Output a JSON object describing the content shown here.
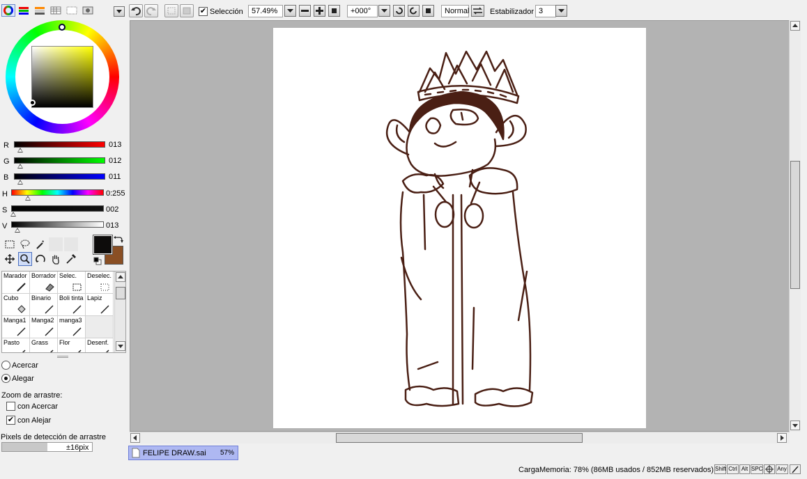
{
  "toolbar": {
    "selection_label": "Selección",
    "selection_checked": true,
    "zoom_value": "57.49%",
    "rotation_value": "+000°",
    "blend_mode": "Normal",
    "stabilizer_label": "Estabilizador",
    "stabilizer_value": "3"
  },
  "color_panel": {
    "tabs": [
      "color-wheel-icon",
      "rgb-sliders-icon",
      "hsv-sliders-icon",
      "swatches-icon",
      "scratchpad-icon",
      "palette-icon"
    ],
    "sliders": [
      {
        "label": "R",
        "value": "013"
      },
      {
        "label": "G",
        "value": "012"
      },
      {
        "label": "B",
        "value": "011"
      },
      {
        "label": "H",
        "value": "0:255"
      },
      {
        "label": "S",
        "value": "002"
      },
      {
        "label": "V",
        "value": "013"
      }
    ],
    "primary_color": "#0d0c0b",
    "secondary_color": "#8a4f24"
  },
  "brushes": [
    {
      "name": "Marador"
    },
    {
      "name": "Borrador"
    },
    {
      "name": "Selec."
    },
    {
      "name": "Deselec."
    },
    {
      "name": "Cubo"
    },
    {
      "name": "Binario"
    },
    {
      "name": "Boli tinta"
    },
    {
      "name": "Lapiz"
    },
    {
      "name": "Manga1"
    },
    {
      "name": "Manga2"
    },
    {
      "name": "manga3"
    },
    {
      "name": ""
    },
    {
      "name": "Pasto"
    },
    {
      "name": "Grass"
    },
    {
      "name": "Flor"
    },
    {
      "name": "Desenf."
    }
  ],
  "zoom_options": {
    "zoom_in_label": "Acercar",
    "zoom_out_label": "Alegar",
    "selected": "Alegar",
    "drag_zoom_label": "Zoom de arrastre:",
    "with_zoom_in_label": "con Acercar",
    "with_zoom_in_checked": false,
    "with_zoom_out_label": "con Alejar",
    "with_zoom_out_checked": true,
    "drag_pixels_label": "Pixels de detección de arrastre",
    "drag_pixels_value": "±16pix",
    "drag_pixels_fraction": 0.5
  },
  "document_tab": {
    "filename": "FELIPE DRAW.sai",
    "zoom": "57%"
  },
  "status": {
    "memory_text": "CargaMemoria: 78% (86MB usados / 852MB reservados)",
    "modifiers": [
      "Shift",
      "Ctrl",
      "Alt",
      "SPC",
      "",
      "Any"
    ]
  },
  "colors": {
    "ink": "#4a1f14",
    "canvas_bg": "#b3b3b3",
    "accent": "#aeb8f2"
  }
}
